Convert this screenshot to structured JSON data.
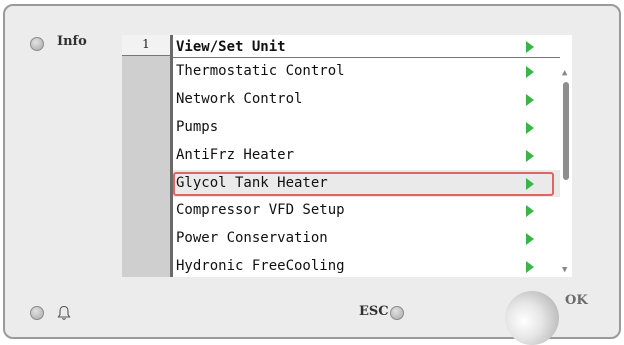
{
  "buttons": {
    "info_label": "Info",
    "esc_label": "ESC",
    "ok_label": "OK"
  },
  "screen": {
    "page_number": "1",
    "header": "View/Set Unit",
    "menu_items": [
      {
        "label": "Thermostatic Control",
        "selected": false
      },
      {
        "label": "Network Control",
        "selected": false
      },
      {
        "label": "Pumps",
        "selected": false
      },
      {
        "label": "AntiFrz Heater",
        "selected": false
      },
      {
        "label": "Glycol Tank Heater",
        "selected": true
      },
      {
        "label": "Compressor VFD Setup",
        "selected": false
      },
      {
        "label": "Power Conservation",
        "selected": false
      },
      {
        "label": "Hydronic FreeCooling",
        "selected": false
      }
    ],
    "scroll_position_fraction": 0.0
  },
  "icons": {
    "submenu_arrow": "green-right-triangle-icon",
    "alarm": "bell-icon"
  },
  "colors": {
    "arrow": "#39b54a",
    "selection_border": "#e06464",
    "panel_background": "#ececec"
  }
}
